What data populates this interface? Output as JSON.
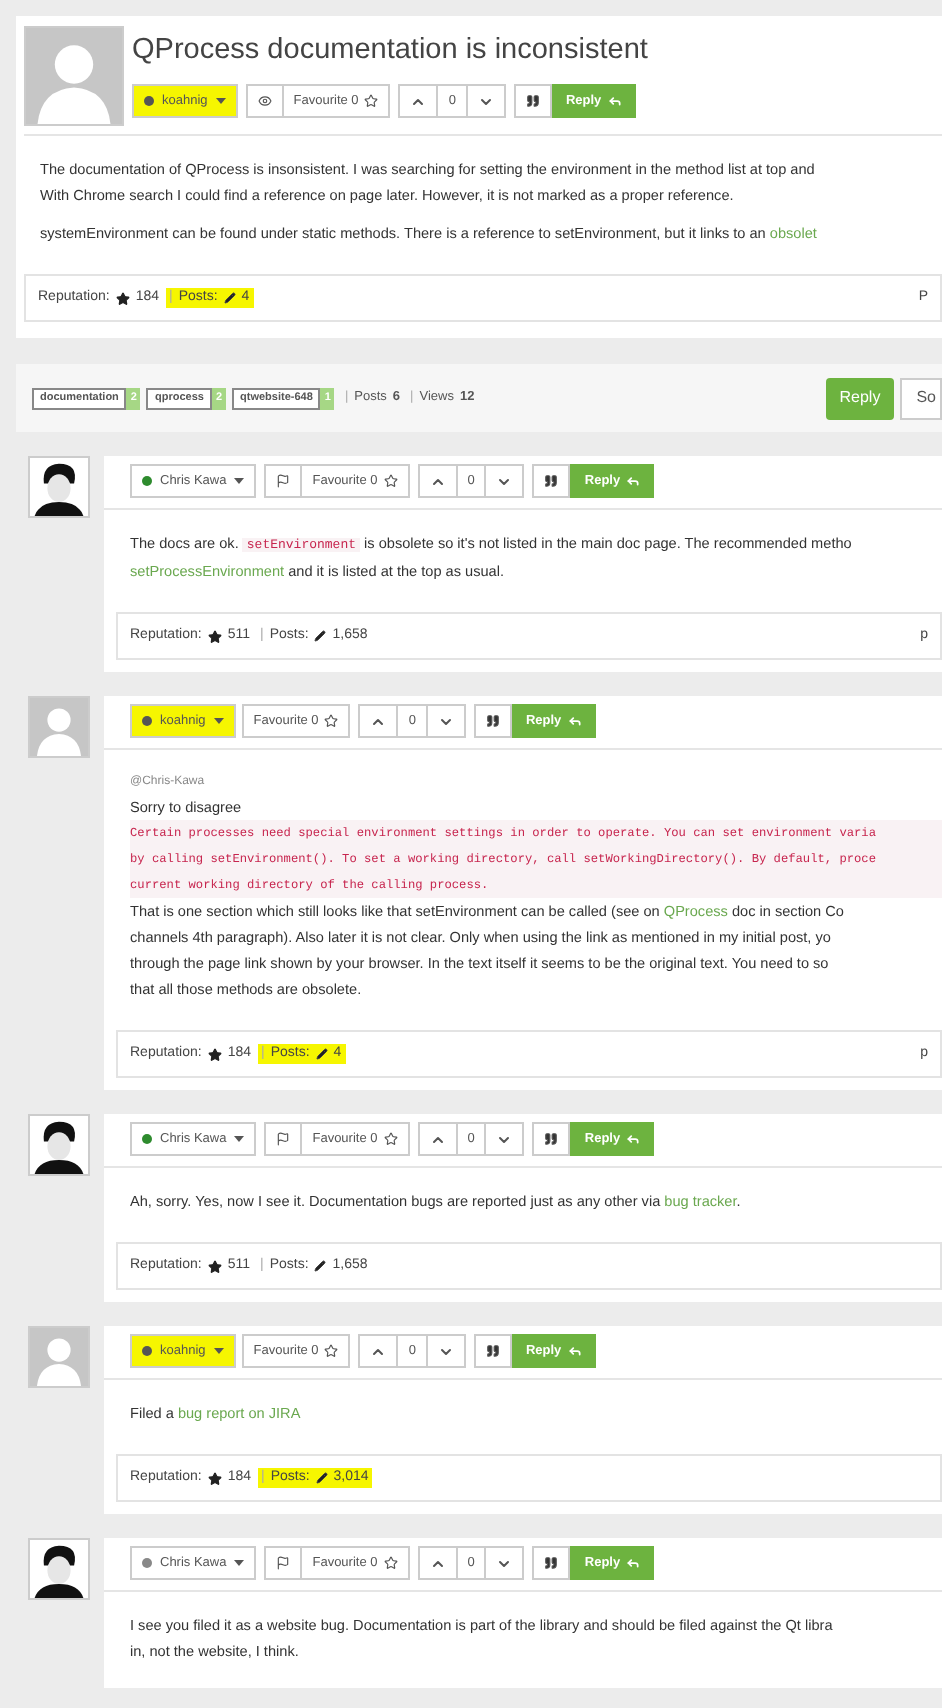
{
  "topic": {
    "title": "QProcess documentation is inconsistent"
  },
  "tag_bar": {
    "tags": [
      {
        "label": "documentation",
        "count": "2"
      },
      {
        "label": "qprocess",
        "count": "2"
      },
      {
        "label": "qtwebsite-648",
        "count": "1"
      }
    ],
    "stats": [
      {
        "separator": "|",
        "label": "Posts",
        "value": "6"
      },
      {
        "separator": "|",
        "label": "Views",
        "value": "12"
      }
    ],
    "reply": "Reply",
    "sort": "So"
  },
  "posts": [
    {
      "author": "koahnig",
      "status": {
        "color": "#555555"
      },
      "highlighted": true,
      "avatar": {
        "kind": "default"
      },
      "side_button": {
        "kind": "eye"
      },
      "favourite": "Favourite 0",
      "votes": "0",
      "reply": "Reply",
      "body": [
        {
          "kind": "para",
          "lines": [
            [
              {
                "kind": "plain",
                "text": "The documentation of QProcess is insonsistent. I was searching for setting the environment in the method list at top and"
              }
            ],
            [
              {
                "kind": "plain",
                "text": "With Chrome search I could find a reference on page later. However, it is not marked as a proper reference."
              }
            ]
          ]
        },
        {
          "kind": "para",
          "lines": [
            [
              {
                "kind": "plain",
                "text": "systemEnvironment can be found under static methods. There is a reference to setEnvironment, but it links to an "
              },
              {
                "kind": "link",
                "text": "obsolet"
              }
            ]
          ]
        }
      ],
      "footer": {
        "reputation_label": "Reputation:",
        "reputation": "184",
        "separator": "|",
        "posts_label": "Posts:",
        "posts": "4",
        "highlighted": true,
        "right": "P"
      }
    },
    {
      "author": "Chris Kawa",
      "status": {
        "color": "#2e8b2e"
      },
      "highlighted": false,
      "avatar": {
        "kind": "photo"
      },
      "side_button": {
        "kind": "flag"
      },
      "favourite": "Favourite 0",
      "votes": "0",
      "reply": "Reply",
      "body": [
        {
          "kind": "para",
          "lines": [
            [
              {
                "kind": "plain",
                "text": "The docs are ok. "
              },
              {
                "kind": "code",
                "text": "setEnvironment"
              },
              {
                "kind": "plain",
                "text": " is obsolete so it's not listed in the main doc page. The recommended metho"
              }
            ],
            [
              {
                "kind": "link",
                "text": "setProcessEnvironment"
              },
              {
                "kind": "plain",
                "text": " and it is listed at the top as usual."
              }
            ]
          ]
        }
      ],
      "footer": {
        "reputation_label": "Reputation:",
        "reputation": "511",
        "separator": "|",
        "posts_label": "Posts:",
        "posts": "1,658",
        "highlighted": false,
        "right": "p"
      }
    },
    {
      "author": "koahnig",
      "status": {
        "color": "#555555"
      },
      "highlighted": true,
      "avatar": {
        "kind": "default"
      },
      "favourite": "Favourite 0",
      "votes": "0",
      "reply": "Reply",
      "body": [
        {
          "kind": "mention",
          "lines": [
            [
              {
                "kind": "plain",
                "text": "@Chris-Kawa"
              }
            ]
          ]
        },
        {
          "kind": "line",
          "lines": [
            [
              {
                "kind": "plain",
                "text": "Sorry to disagree"
              }
            ]
          ]
        },
        {
          "kind": "codeblock",
          "lines": [
            [
              {
                "kind": "plain",
                "text": "Certain processes need special environment settings in order to operate. You can set environment varia"
              }
            ],
            [
              {
                "kind": "plain",
                "text": "by calling setEnvironment(). To set a working directory, call setWorkingDirectory(). By default, proce"
              }
            ],
            [
              {
                "kind": "plain",
                "text": "current working directory of the calling process."
              }
            ]
          ]
        },
        {
          "kind": "line",
          "lines": [
            [
              {
                "kind": "plain",
                "text": "That is one section which still looks like that setEnvironment can be called (see on "
              },
              {
                "kind": "link",
                "text": "QProcess"
              },
              {
                "kind": "plain",
                "text": " doc in section Co"
              }
            ],
            [
              {
                "kind": "plain",
                "text": "channels 4th paragraph). Also later it is not clear. Only when using the link as mentioned in my initial post, yo"
              }
            ],
            [
              {
                "kind": "plain",
                "text": "through the page link shown by your browser. In the text itself it seems to be the original text. You need to so"
              }
            ],
            [
              {
                "kind": "plain",
                "text": "that all those methods are obsolete."
              }
            ]
          ]
        }
      ],
      "footer": {
        "reputation_label": "Reputation:",
        "reputation": "184",
        "separator": "|",
        "posts_label": "Posts:",
        "posts": "4",
        "highlighted": true,
        "right": "p"
      }
    },
    {
      "author": "Chris Kawa",
      "status": {
        "color": "#2e8b2e"
      },
      "highlighted": false,
      "avatar": {
        "kind": "photo"
      },
      "side_button": {
        "kind": "flag"
      },
      "favourite": "Favourite 0",
      "votes": "0",
      "reply": "Reply",
      "body": [
        {
          "kind": "para",
          "lines": [
            [
              {
                "kind": "plain",
                "text": "Ah, sorry. Yes, now I see it. Documentation bugs are reported just as any other via "
              },
              {
                "kind": "link",
                "text": "bug tracker"
              },
              {
                "kind": "plain",
                "text": "."
              }
            ]
          ]
        }
      ],
      "footer": {
        "reputation_label": "Reputation:",
        "reputation": "511",
        "separator": "|",
        "posts_label": "Posts:",
        "posts": "1,658",
        "highlighted": false
      }
    },
    {
      "author": "koahnig",
      "status": {
        "color": "#555555"
      },
      "highlighted": true,
      "avatar": {
        "kind": "default"
      },
      "favourite": "Favourite 0",
      "votes": "0",
      "reply": "Reply",
      "body": [
        {
          "kind": "para",
          "lines": [
            [
              {
                "kind": "plain",
                "text": "Filed a "
              },
              {
                "kind": "link",
                "text": "bug report on JIRA"
              }
            ]
          ]
        }
      ],
      "footer": {
        "reputation_label": "Reputation:",
        "reputation": "184",
        "separator": "|",
        "posts_label": "Posts:",
        "posts": "3,014",
        "highlighted": true
      }
    },
    {
      "author": "Chris Kawa",
      "status": {
        "color": "#888888"
      },
      "highlighted": false,
      "avatar": {
        "kind": "photo"
      },
      "side_button": {
        "kind": "flag"
      },
      "favourite": "Favourite 0",
      "votes": "0",
      "reply": "Reply",
      "body": [
        {
          "kind": "para",
          "lines": [
            [
              {
                "kind": "plain",
                "text": "I see you filed it as a website bug. Documentation is part of the library and should be filed against the Qt libra"
              }
            ],
            [
              {
                "kind": "plain",
                "text": "in, not the website, I think."
              }
            ]
          ]
        }
      ]
    }
  ]
}
